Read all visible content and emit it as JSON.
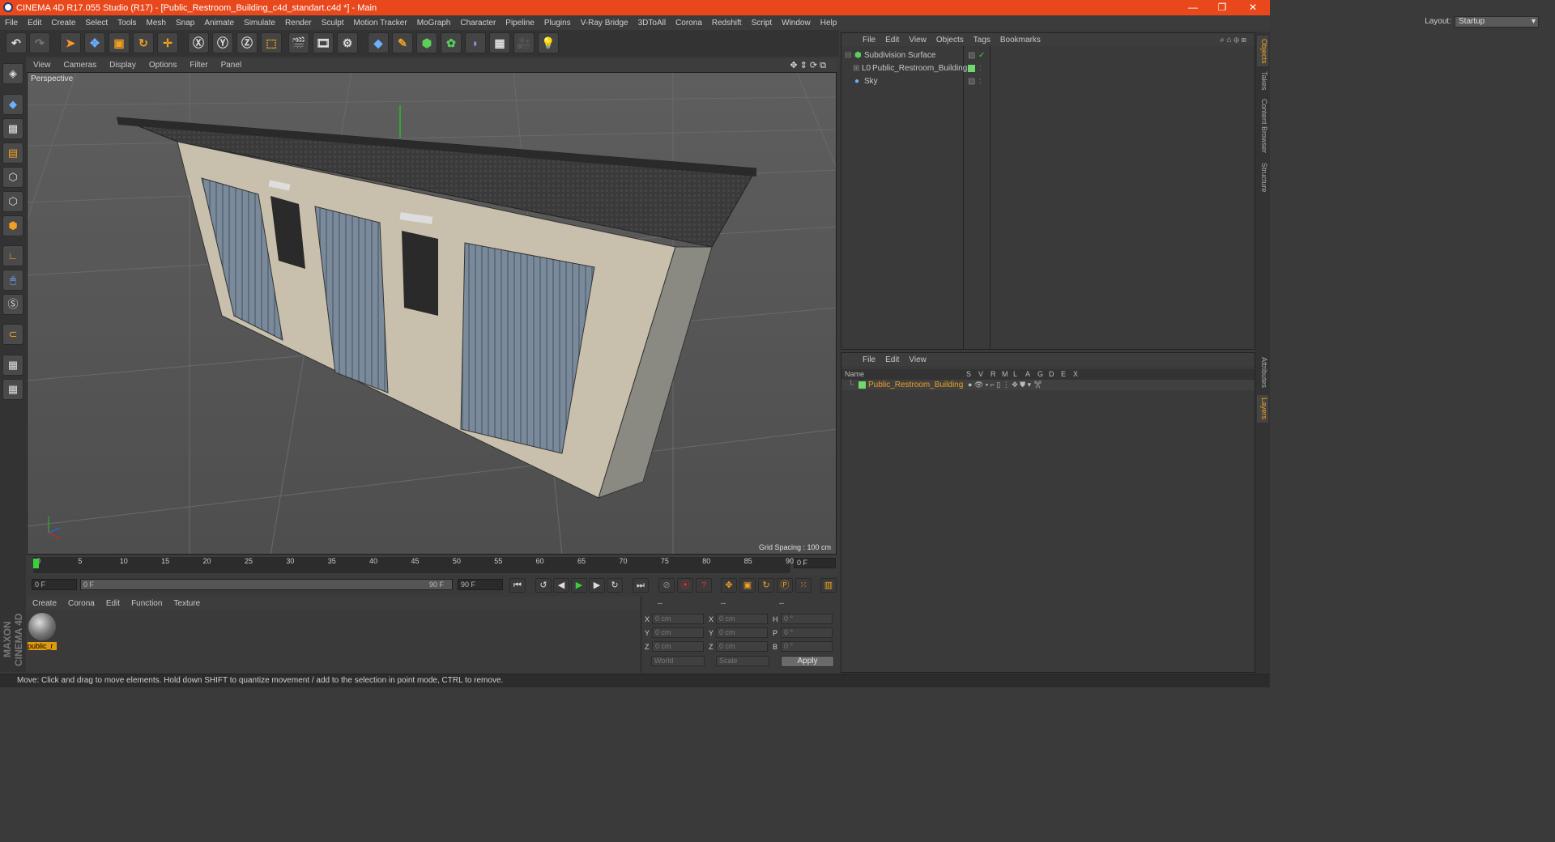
{
  "titlebar": {
    "title": "CINEMA 4D R17.055 Studio (R17) - [Public_Restroom_Building_c4d_standart.c4d *] - Main",
    "min": "—",
    "max": "❐",
    "close": "✕"
  },
  "menubar": {
    "items": [
      "File",
      "Edit",
      "Create",
      "Select",
      "Tools",
      "Mesh",
      "Snap",
      "Animate",
      "Simulate",
      "Render",
      "Sculpt",
      "Motion Tracker",
      "MoGraph",
      "Character",
      "Pipeline",
      "Plugins",
      "V-Ray Bridge",
      "3DToAll",
      "Corona",
      "Redshift",
      "Script",
      "Window",
      "Help"
    ],
    "layout_label": "Layout:",
    "layout_value": "Startup"
  },
  "viewport": {
    "menu": [
      "View",
      "Cameras",
      "Display",
      "Options",
      "Filter",
      "Panel"
    ],
    "label": "Perspective",
    "grid_spacing": "Grid Spacing : 100 cm"
  },
  "timeline": {
    "ticks": [
      "0",
      "5",
      "10",
      "15",
      "20",
      "25",
      "30",
      "35",
      "40",
      "45",
      "50",
      "55",
      "60",
      "65",
      "70",
      "75",
      "80",
      "85",
      "90"
    ],
    "current_frame": "0 F",
    "start_field": "0 F",
    "range_start": "0 F",
    "range_end": "90 F",
    "end_field": "90 F"
  },
  "material": {
    "menu": [
      "Create",
      "Corona",
      "Edit",
      "Function",
      "Texture"
    ],
    "name": "public_r"
  },
  "coords": {
    "headers": [
      "--",
      "--",
      "--"
    ],
    "rows": [
      {
        "a": "X",
        "av": "0 cm",
        "b": "X",
        "bv": "0 cm",
        "c": "H",
        "cv": "0 °"
      },
      {
        "a": "Y",
        "av": "0 cm",
        "b": "Y",
        "bv": "0 cm",
        "c": "P",
        "cv": "0 °"
      },
      {
        "a": "Z",
        "av": "0 cm",
        "b": "Z",
        "bv": "0 cm",
        "c": "B",
        "cv": "0 °"
      }
    ],
    "space": "World",
    "mode": "Scale",
    "apply": "Apply"
  },
  "status": "Move: Click and drag to move elements. Hold down SHIFT to quantize movement / add to the selection in point mode, CTRL to remove.",
  "objects": {
    "menu": [
      "File",
      "Edit",
      "View",
      "Objects",
      "Tags",
      "Bookmarks"
    ],
    "items": [
      "Subdivision Surface",
      "Public_Restroom_Building",
      "Sky"
    ]
  },
  "layers": {
    "menu": [
      "File",
      "Edit",
      "View"
    ],
    "columns": [
      "Name",
      "S",
      "V",
      "R",
      "M",
      "L",
      "A",
      "G",
      "D",
      "E",
      "X"
    ],
    "row_name": "Public_Restroom_Building",
    "layer_color": "#6fd86f"
  },
  "right_tabs": [
    "Objects",
    "Takes",
    "Content Browser",
    "Structure",
    "Attributes",
    "Layers"
  ],
  "branding": "MAXON CINEMA 4D",
  "colors": {
    "title_bar": "#e8481c",
    "accent": "#f0a020"
  }
}
